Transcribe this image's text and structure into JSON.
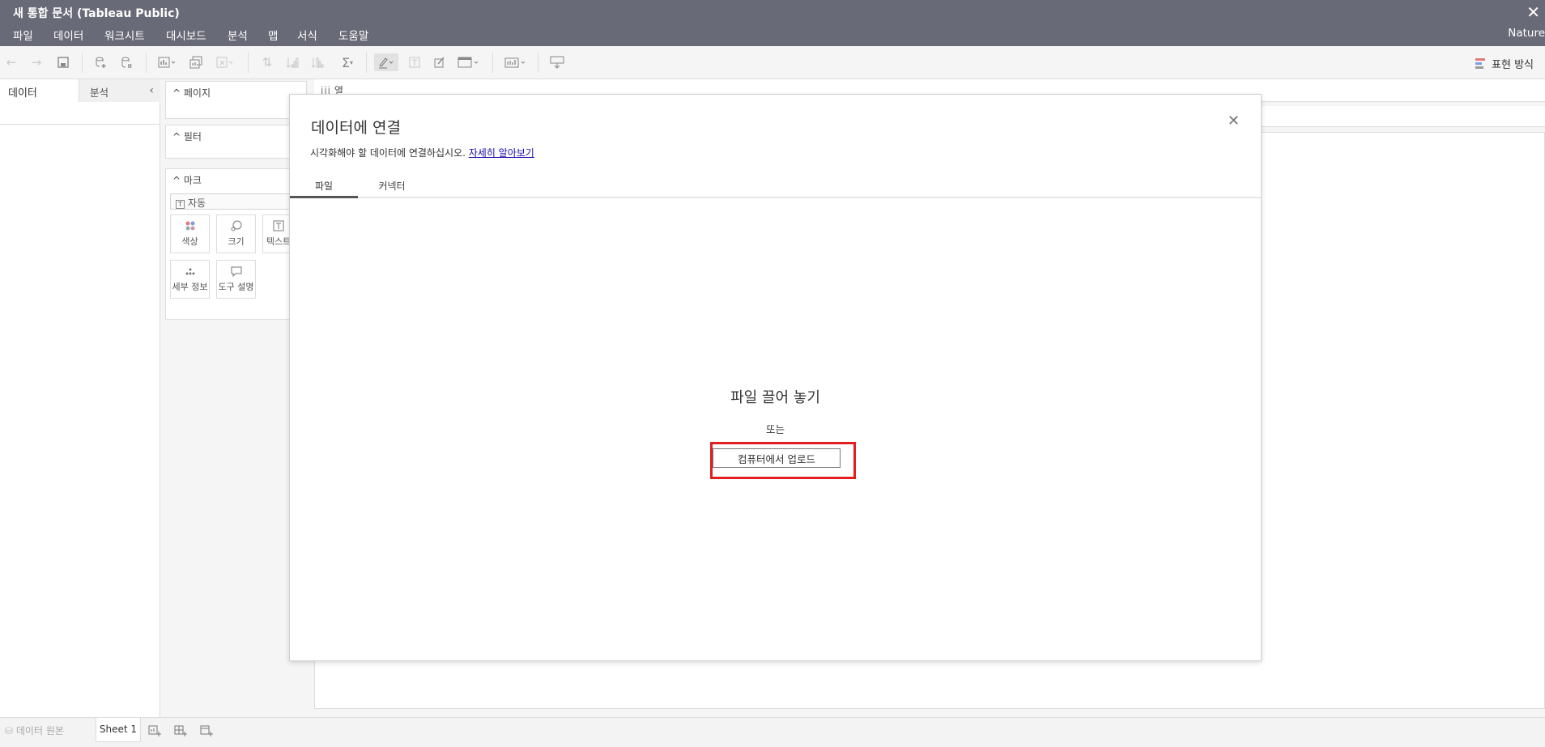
{
  "window": {
    "title": "새 통합 문서 (Tableau Public)",
    "close_glyph": "✕"
  },
  "menu": {
    "items": [
      "파일",
      "데이터",
      "워크시트",
      "대시보드",
      "분석",
      "맵",
      "서식",
      "도움말"
    ],
    "right_text": "Nature"
  },
  "toolbar": {
    "show_me_label": "표현 방식",
    "show_me_colors": [
      "#e07b7b",
      "#7b9fe0",
      "#9a9a9a"
    ]
  },
  "left_panel": {
    "tab_data": "데이터",
    "tab_analysis": "분석",
    "collapse_glyph": "‹"
  },
  "shelves": {
    "pages": "페이지",
    "filters": "필터",
    "marks": "마크",
    "mark_type": "자동",
    "mark_buttons": [
      "색상",
      "크기",
      "텍스트",
      "세부 정보",
      "도구 설명"
    ],
    "columns": "열"
  },
  "bottom": {
    "data_source": "데이터 원본",
    "sheet": "Sheet 1"
  },
  "dialog": {
    "title": "데이터에 연결",
    "description": "시각화해야 할 데이터에 연결하십시오.",
    "learn_more": "자세히 알아보기",
    "tabs": [
      "파일",
      "커넥터"
    ],
    "drop_text": "파일 끌어 놓기",
    "or_text": "또는",
    "upload_button": "컴퓨터에서 업로드",
    "close_glyph": "✕"
  },
  "annotation": {
    "highlight_color": "#e02020"
  }
}
